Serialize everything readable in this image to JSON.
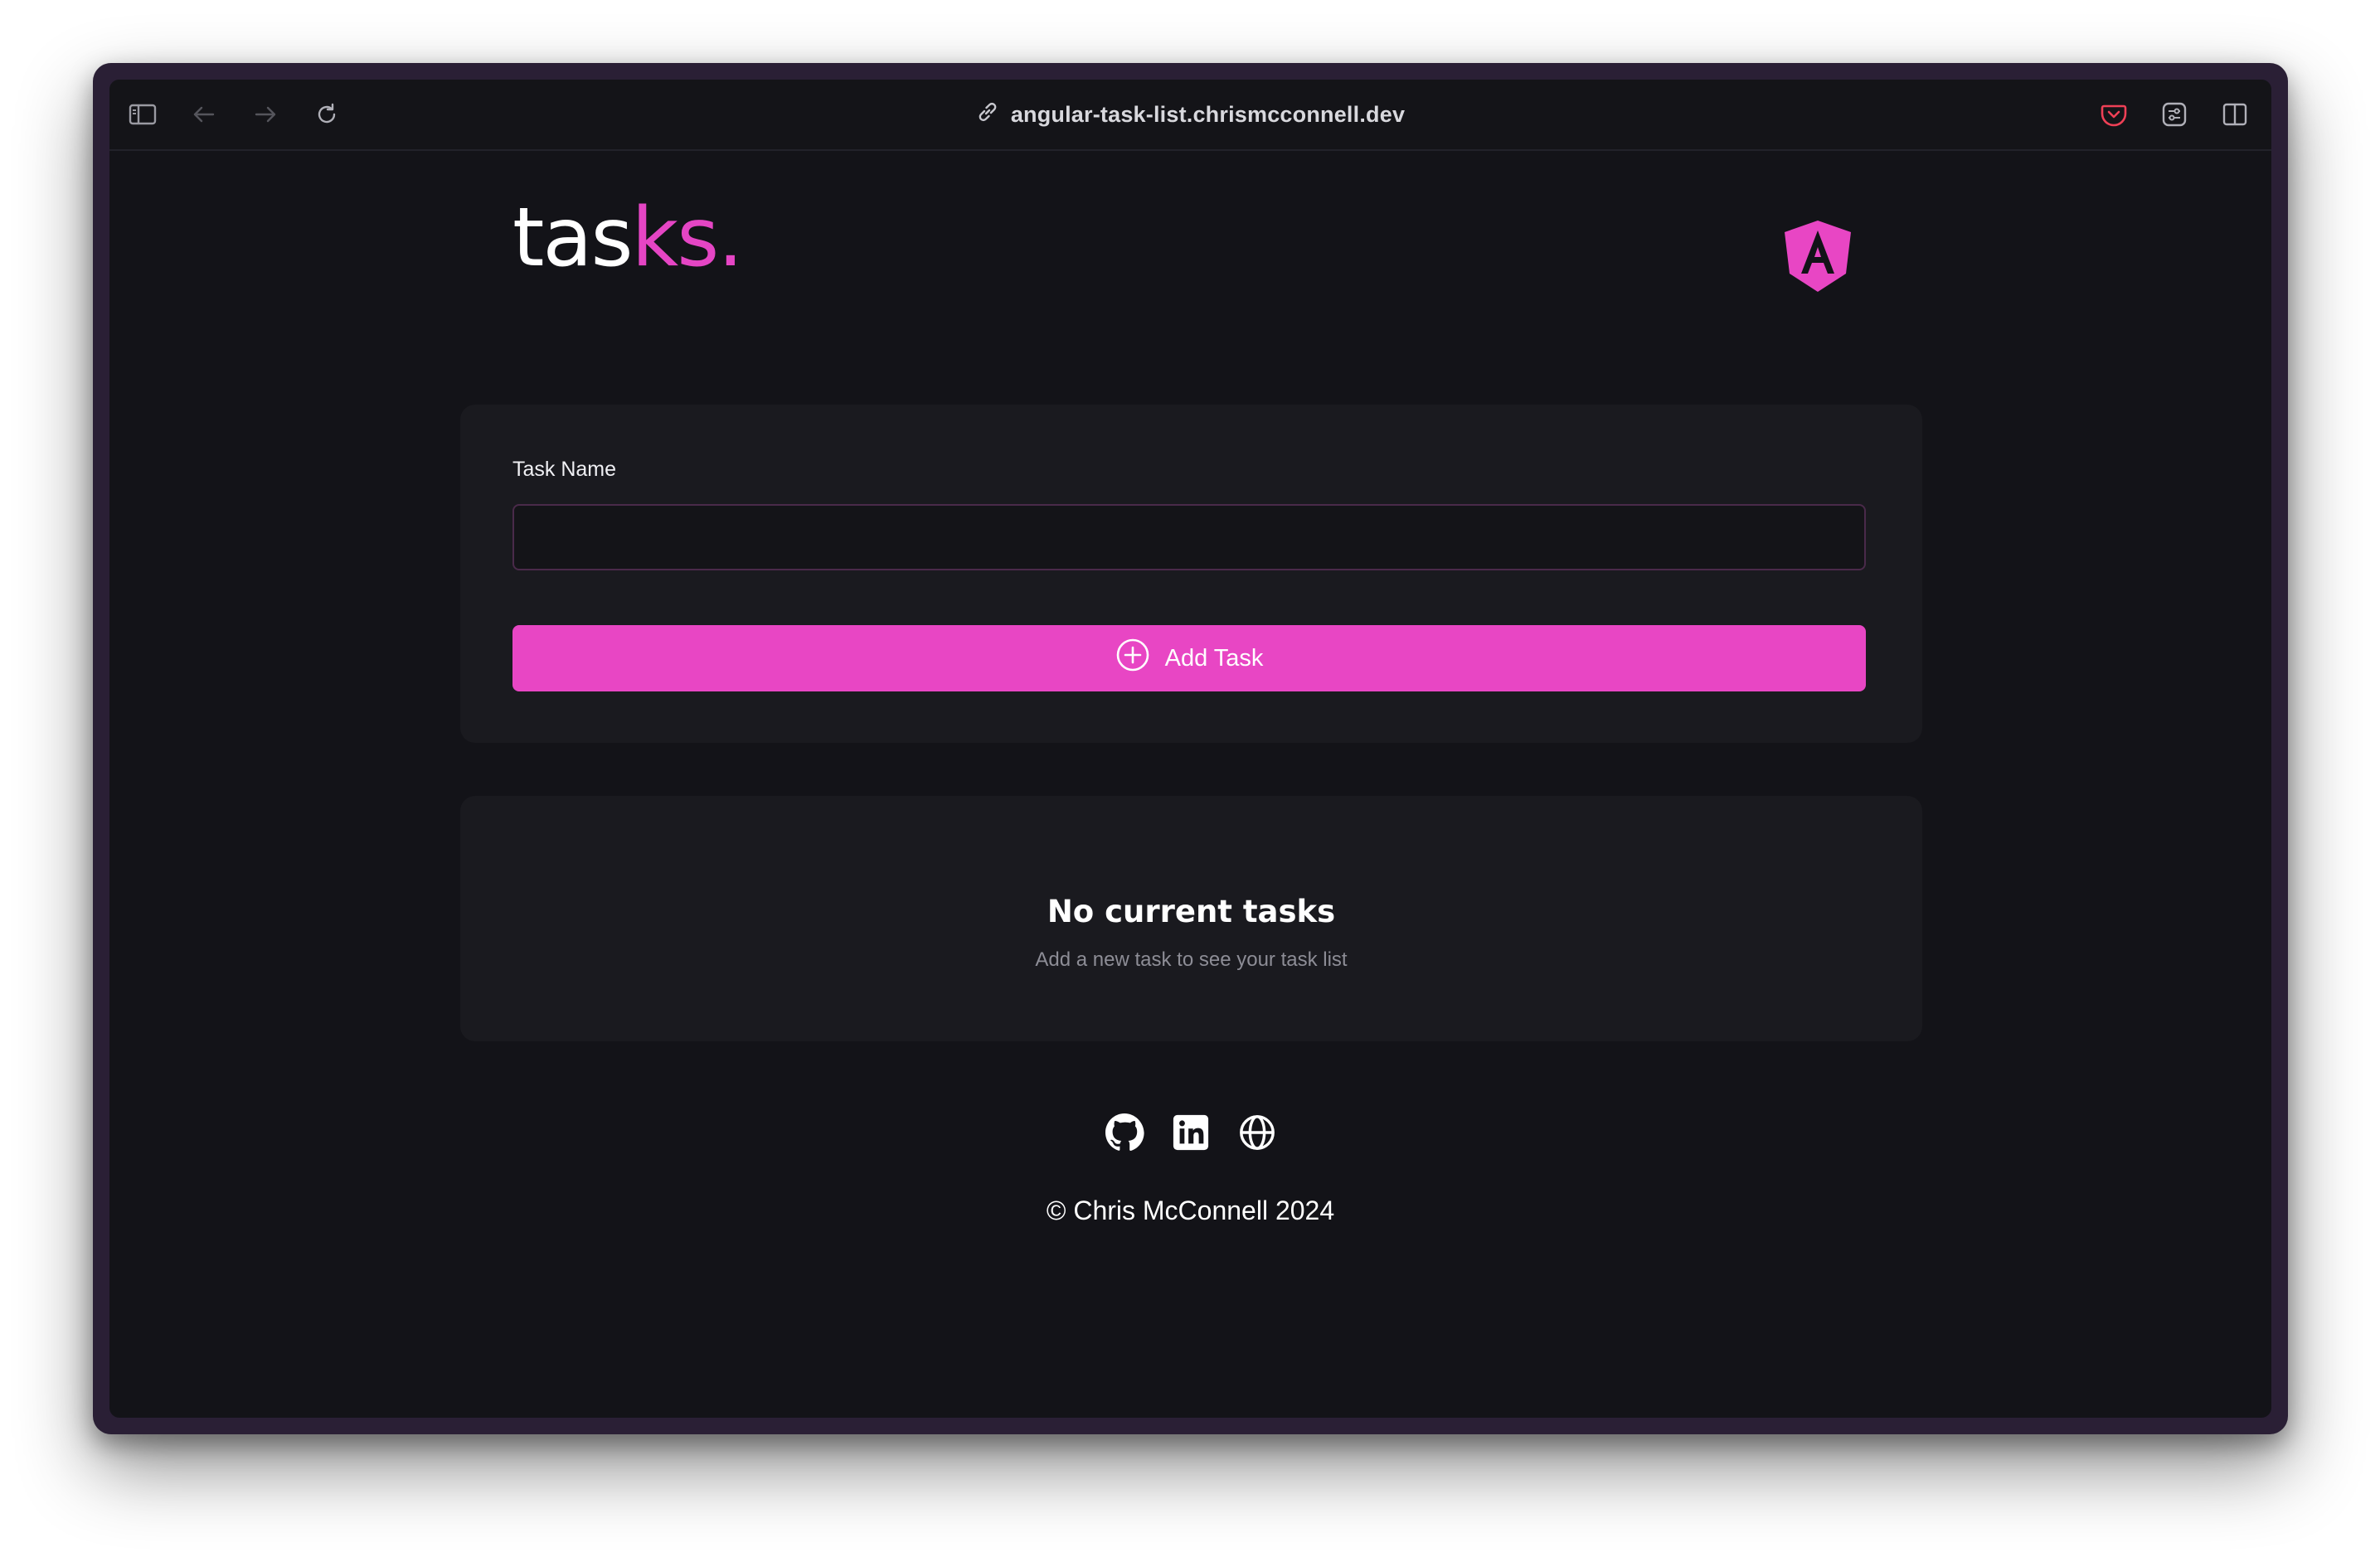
{
  "browser": {
    "url": "angular-task-list.chrismcconnell.dev",
    "icons": [
      "sidebar-icon",
      "back-arrow-icon",
      "forward-arrow-icon",
      "reload-icon",
      "link-icon",
      "pocket-icon",
      "extensions-icon",
      "split-view-icon"
    ]
  },
  "header": {
    "logo_part1": "tas",
    "logo_part2": "ks.",
    "logo_icon": "angular-logo-icon"
  },
  "form": {
    "label": "Task Name",
    "input_value": "",
    "button_label": "Add Task",
    "button_icon": "plus-circle-icon"
  },
  "empty_state": {
    "title": "No current tasks",
    "subtitle": "Add a new task to see your task list"
  },
  "footer": {
    "links": [
      "github-icon",
      "linkedin-icon",
      "globe-icon"
    ],
    "copyright": "© Chris McConnell 2024"
  },
  "colors": {
    "accent": "#e846c4",
    "background": "#131318",
    "card": "#1a1a1f"
  }
}
